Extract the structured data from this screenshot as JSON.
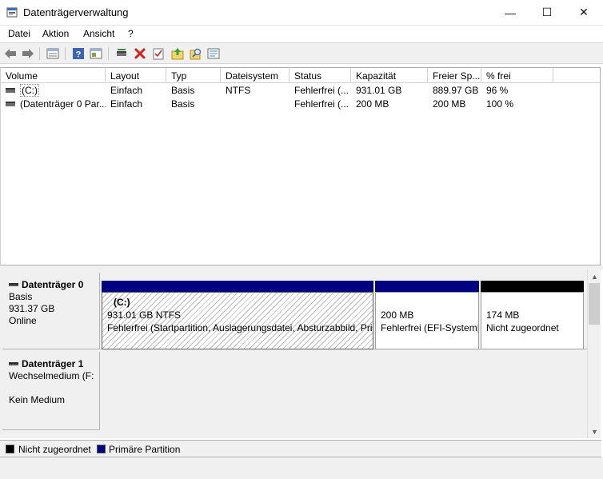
{
  "window": {
    "title": "Datenträgerverwaltung",
    "minimize": "—",
    "maximize": "☐",
    "close": "✕"
  },
  "menu": [
    "Datei",
    "Aktion",
    "Ansicht",
    "?"
  ],
  "toolbar_icons": [
    "back-arrow-icon",
    "forward-arrow-icon",
    "list-view-icon",
    "help-icon",
    "properties-icon",
    "connect-icon",
    "delete-icon",
    "check-icon",
    "import-icon",
    "search-icon",
    "settings-icon"
  ],
  "table": {
    "columns": [
      "Volume",
      "Layout",
      "Typ",
      "Dateisystem",
      "Status",
      "Kapazität",
      "Freier Sp...",
      "% frei"
    ],
    "rows": [
      [
        "(C:)",
        "Einfach",
        "Basis",
        "NTFS",
        "Fehlerfrei (...",
        "931.01 GB",
        "889.97 GB",
        "96 %"
      ],
      [
        "(Datenträger 0 Par...",
        "Einfach",
        "Basis",
        "",
        "Fehlerfrei (...",
        "200 MB",
        "200 MB",
        "100 %"
      ]
    ]
  },
  "disks": [
    {
      "name": "Datenträger 0",
      "type": "Basis",
      "size": "931.37 GB",
      "status": "Online",
      "partitions": [
        {
          "title": "(C:)",
          "size": "931.01 GB NTFS",
          "status": "Fehlerfrei (Startpartition, Auslagerungsdatei, Absturzabbild, Pri",
          "kind": "primary",
          "selected": true
        },
        {
          "title": "",
          "size": "200 MB",
          "status": "Fehlerfrei (EFI-System|",
          "kind": "primary",
          "selected": false
        },
        {
          "title": "",
          "size": "174 MB",
          "status": "Nicht zugeordnet",
          "kind": "unallocated",
          "selected": false
        }
      ]
    },
    {
      "name": "Datenträger 1",
      "type": "Wechselmedium (F:",
      "status": "Kein Medium"
    }
  ],
  "legend": [
    {
      "label": "Nicht zugeordnet",
      "color": "#000000"
    },
    {
      "label": "Primäre Partition",
      "color": "#000080"
    }
  ],
  "colors": {
    "primary_bar": "#000080",
    "unallocated_bar": "#000000"
  }
}
